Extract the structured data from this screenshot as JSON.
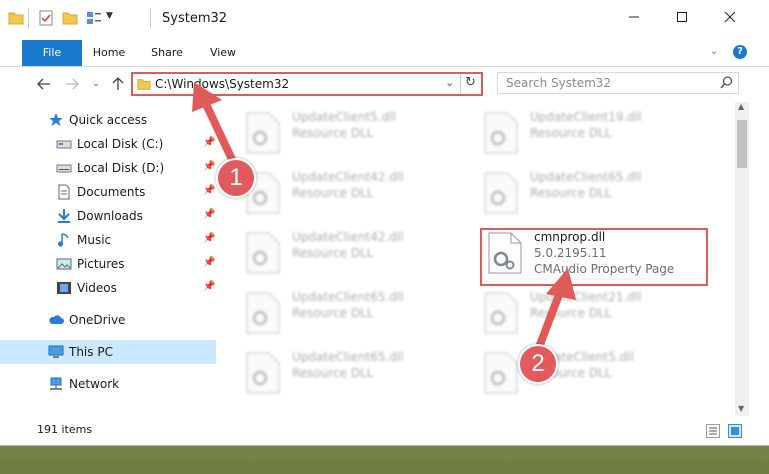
{
  "window": {
    "title": "System32"
  },
  "ribbon": {
    "tabs": [
      "File",
      "Home",
      "Share",
      "View"
    ]
  },
  "address": {
    "path": "C:\\Windows\\System32",
    "search_placeholder": "Search System32"
  },
  "sidebar": {
    "items": [
      {
        "label": "Quick access",
        "pinned": false
      },
      {
        "label": "Local Disk (C:)",
        "pinned": true
      },
      {
        "label": "Local Disk (D:)",
        "pinned": true
      },
      {
        "label": "Documents",
        "pinned": true
      },
      {
        "label": "Downloads",
        "pinned": true
      },
      {
        "label": "Music",
        "pinned": true
      },
      {
        "label": "Pictures",
        "pinned": true
      },
      {
        "label": "Videos",
        "pinned": true
      },
      {
        "label": "OneDrive",
        "pinned": false
      },
      {
        "label": "This PC",
        "pinned": false
      },
      {
        "label": "Network",
        "pinned": false
      }
    ]
  },
  "files": {
    "left": [
      {
        "name": "UpdateClient5.dll",
        "type": "Resource DLL"
      },
      {
        "name": "UpdateClient42.dll",
        "type": "Resource DLL"
      },
      {
        "name": "UpdateClient42.dll",
        "type": "Resource DLL"
      },
      {
        "name": "UpdateClient65.dll",
        "type": "Resource DLL"
      },
      {
        "name": "UpdateClient65.dll",
        "type": "Resource DLL"
      }
    ],
    "right": [
      {
        "name": "UpdateClient19.dll",
        "type": "Resource DLL"
      },
      {
        "name": "UpdateClient65.dll",
        "type": "Resource DLL"
      },
      {
        "name": "UpdateClient21.dll",
        "type": "Resource DLL"
      },
      {
        "name": "UpdateClient5.dll",
        "type": "Resource DLL"
      }
    ],
    "highlighted": {
      "name": "cmnprop.dll",
      "version": "5.0.2195.11",
      "description": "CMAudio Property Page"
    }
  },
  "status": {
    "item_count": "191 items"
  },
  "annotations": {
    "badge1": "1",
    "badge2": "2"
  },
  "colors": {
    "accent": "#1979ca",
    "annotation": "#e05a5a",
    "selected": "#cce8ff"
  }
}
